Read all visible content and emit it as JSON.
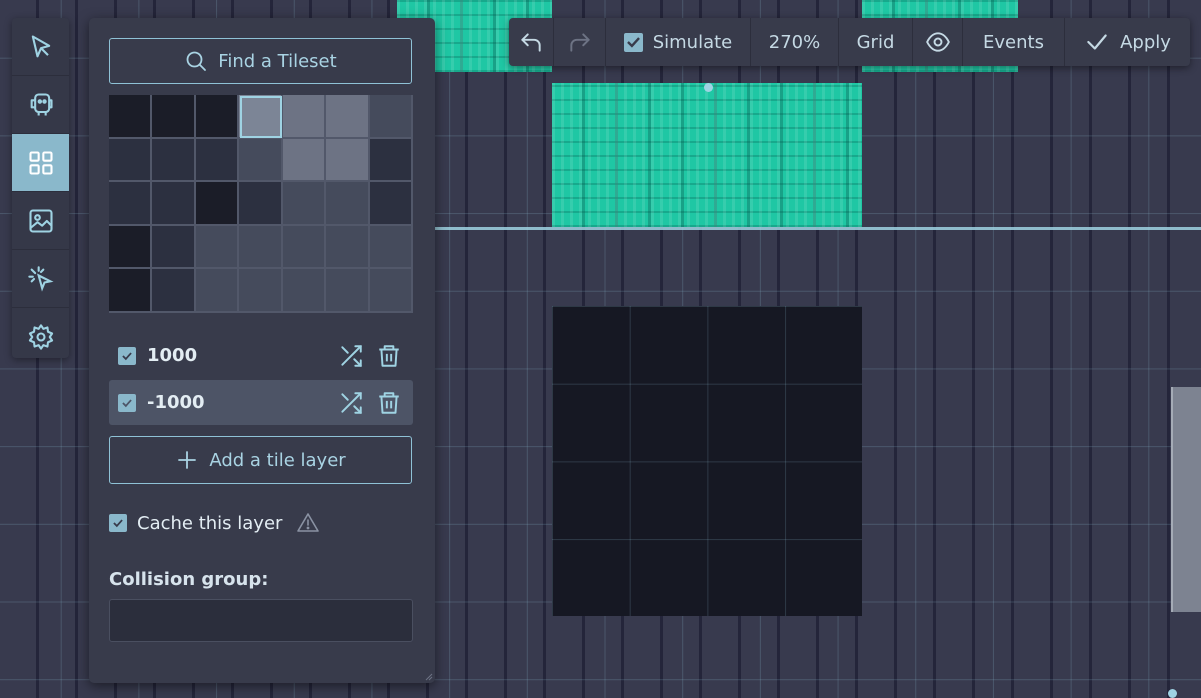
{
  "panel": {
    "find_tileset_label": "Find a Tileset",
    "layers": [
      {
        "name": "1000",
        "checked": true,
        "selected": false
      },
      {
        "name": "-1000",
        "checked": true,
        "selected": true
      }
    ],
    "add_layer_label": "Add a tile layer",
    "cache_label": "Cache this layer",
    "cache_checked": true,
    "collision_label": "Collision group:",
    "collision_value": "",
    "collision_placeholder": ""
  },
  "toolbar": {
    "undo_icon": "undo-icon",
    "redo_icon": "redo-icon",
    "simulate_label": "Simulate",
    "simulate_checked": true,
    "zoom_label": "270%",
    "grid_label": "Grid",
    "visibility_icon": "eye-icon",
    "events_label": "Events",
    "apply_label": "Apply"
  },
  "tools": [
    {
      "name": "select",
      "icon": "cursor-icon",
      "active": false
    },
    {
      "name": "entities",
      "icon": "copy-icon",
      "active": false
    },
    {
      "name": "tiles",
      "icon": "grid-icon",
      "active": true
    },
    {
      "name": "backgrounds",
      "icon": "image-icon",
      "active": false
    },
    {
      "name": "effects",
      "icon": "cursor-click-icon",
      "active": false
    },
    {
      "name": "settings",
      "icon": "gear-icon",
      "active": false
    }
  ],
  "colors": {
    "accent": "#8ab8cb",
    "panel_bg": "#383b4b",
    "tile_green": "#1fc7a4",
    "canvas_bg": "#2b2c3d"
  }
}
